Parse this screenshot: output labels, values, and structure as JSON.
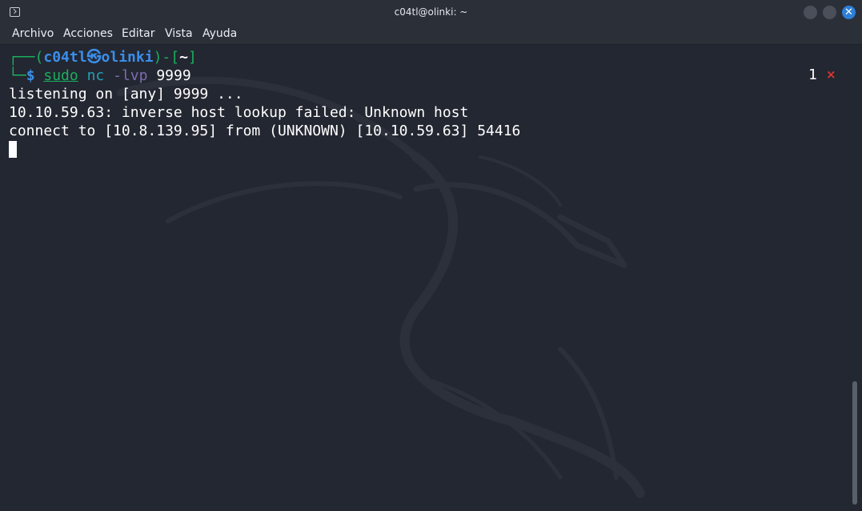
{
  "window": {
    "title": "c04tl@olinki: ~",
    "icon": "terminal-icon",
    "buttons": [
      "minimize-icon",
      "maximize-icon",
      "close-icon"
    ],
    "close_glyph": "✕"
  },
  "menu": {
    "items": [
      "Archivo",
      "Acciones",
      "Editar",
      "Vista",
      "Ayuda"
    ]
  },
  "terminal": {
    "prompt": {
      "corner_top": "┌──(",
      "user": "c04tl",
      "at_symbol": "㉿",
      "host": "olinki",
      "bracket_mid": ")-[",
      "path": "~",
      "bracket_end": "]",
      "corner_bottom": "└─",
      "dollar": "$"
    },
    "command": {
      "sudo": "sudo",
      "nc": "nc",
      "flags": "-lvp",
      "port": "9999"
    },
    "output": [
      "listening on [any] 9999 ...",
      "10.10.59.63: inverse host lookup failed: Unknown host",
      "connect to [10.8.139.95] from (UNKNOWN) [10.10.59.63] 54416"
    ],
    "job_count": "1",
    "job_mark": "×"
  },
  "colors": {
    "background": "#232731",
    "prompt_green": "#1aaf5e",
    "prompt_blue": "#3b8eea",
    "close_button": "#2d7fd8",
    "job_mark_red": "#e0342e"
  }
}
